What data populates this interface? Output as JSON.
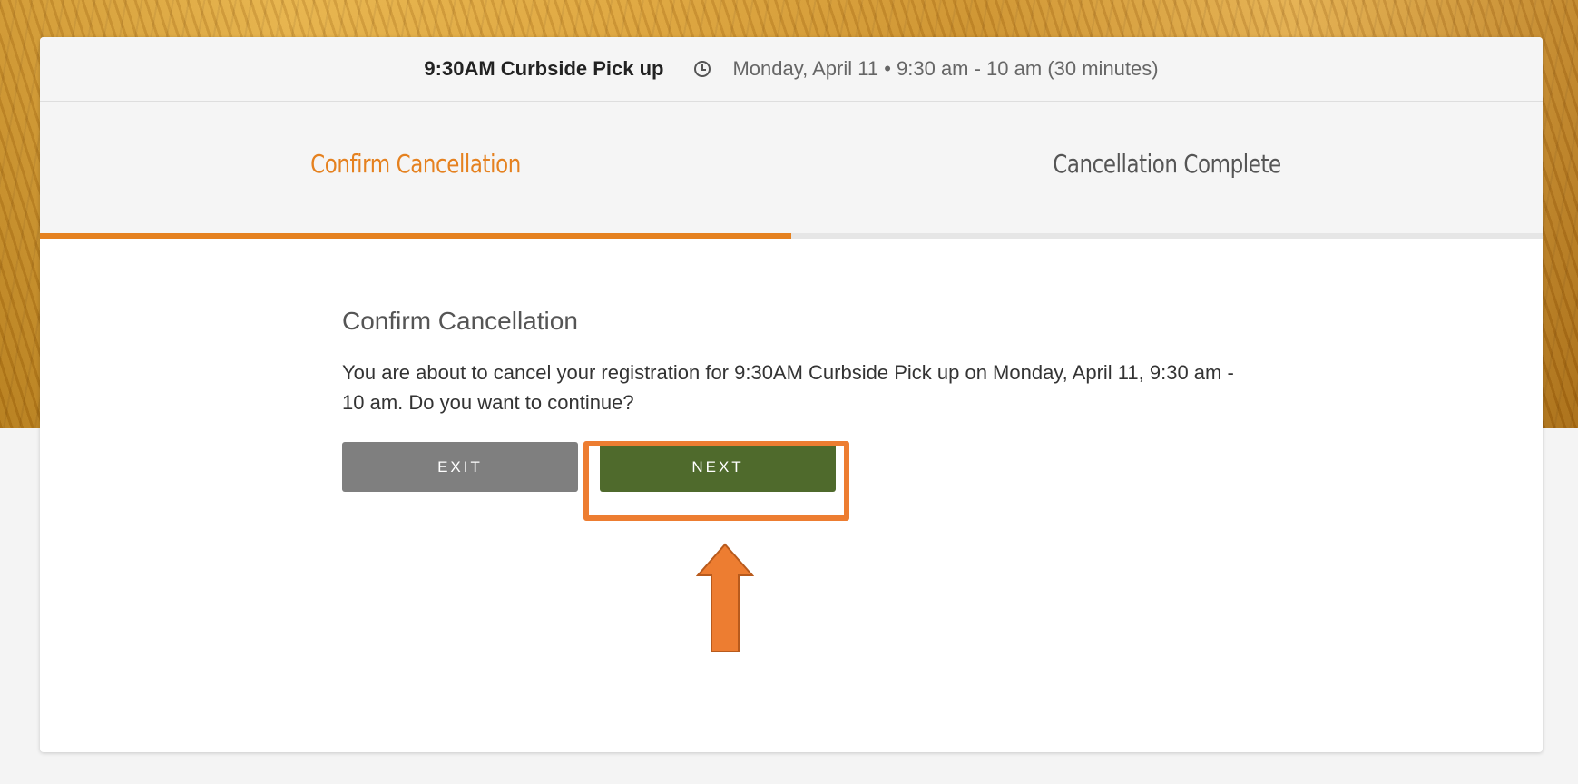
{
  "header": {
    "event_title": "9:30AM Curbside Pick up",
    "icon": "clock-icon",
    "event_time": "Monday, April 11 • 9:30 am - 10 am (30 minutes)"
  },
  "steps": [
    {
      "label": "Confirm Cancellation",
      "state": "active"
    },
    {
      "label": "Cancellation Complete",
      "state": "inactive"
    }
  ],
  "progress": {
    "completed_steps": 1,
    "total_steps": 2
  },
  "content": {
    "heading": "Confirm Cancellation",
    "message": "You are about to cancel your registration for 9:30AM Curbside Pick up on Monday, April 11, 9:30 am - 10 am. Do you want to continue?"
  },
  "buttons": {
    "exit_label": "EXIT",
    "next_label": "NEXT"
  },
  "annotation": {
    "highlight_color": "#ed7d31",
    "arrow_icon": "up-arrow-icon"
  },
  "colors": {
    "accent": "#e5811f",
    "next_button": "#4f6a2c",
    "exit_button": "#7f7f7f"
  }
}
